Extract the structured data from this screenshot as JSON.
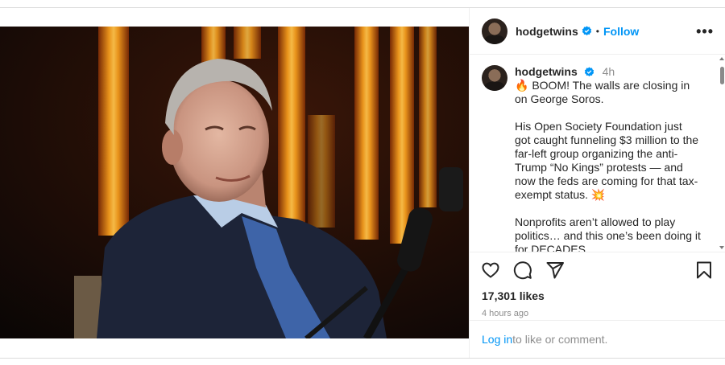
{
  "post": {
    "username": "hodgetwins",
    "verified_icon": "verified-badge-icon",
    "separator": "•",
    "follow_label": "Follow",
    "more_label": "•••",
    "caption": {
      "username": "hodgetwins",
      "time": "4h",
      "paragraphs": [
        "🔥 BOOM! The walls are closing in on George Soros.",
        "His Open Society Foundation just got caught funneling $3 million to the far-left group organizing the anti-Trump “No Kings” protests — and now the feds are coming for that tax-exempt status. 💥",
        "Nonprofits aren’t allowed to play politics… and this one’s been doing it for DECADES."
      ]
    },
    "likes": "17,301 likes",
    "ago": "4 hours ago",
    "login_link": "Log in",
    "login_rest": " to like or comment.",
    "colors": {
      "accent": "#0095f6",
      "text": "#262626",
      "muted": "#8e8e8e"
    }
  }
}
